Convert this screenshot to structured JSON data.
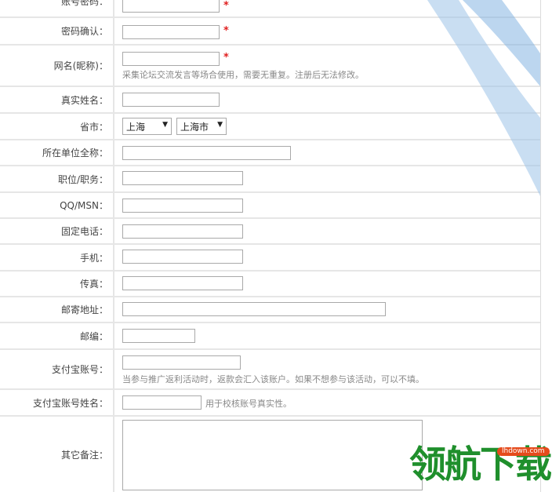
{
  "form": {
    "account_password": {
      "label": "账号密码：",
      "value": ""
    },
    "confirm_password": {
      "label": "密码确认：",
      "value": ""
    },
    "nickname": {
      "label": "网名(昵称)：",
      "value": "",
      "hint": "采集论坛交流发言等场合使用，需要无重复。注册后无法修改。"
    },
    "real_name": {
      "label": "真实姓名：",
      "value": ""
    },
    "province_city": {
      "label": "省市：",
      "province": "上海",
      "city": "上海市"
    },
    "organization": {
      "label": "所在单位全称：",
      "value": ""
    },
    "position": {
      "label": "职位/职务：",
      "value": ""
    },
    "qq_msn": {
      "label": "QQ/MSN：",
      "value": ""
    },
    "landline": {
      "label": "固定电话：",
      "value": ""
    },
    "mobile": {
      "label": "手机：",
      "value": ""
    },
    "fax": {
      "label": "传真：",
      "value": ""
    },
    "address": {
      "label": "邮寄地址：",
      "value": ""
    },
    "postcode": {
      "label": "邮编：",
      "value": ""
    },
    "alipay_account": {
      "label": "支付宝账号：",
      "value": "",
      "hint": "当参与推广返利活动时，返款会汇入该账户。如果不想参与该活动，可以不填。"
    },
    "alipay_name": {
      "label": "支付宝账号姓名：",
      "value": "",
      "hint": "用于校核账号真实性。"
    },
    "remarks": {
      "label": "其它备注：",
      "value": ""
    },
    "required_mark": "*"
  },
  "watermark": {
    "text": "领航下载",
    "badge": "lhdown.com",
    "color": "#1f8f2c",
    "badge_color": "#e54b1c"
  },
  "colors": {
    "border": "#e6e6e6",
    "required": "#e02020",
    "swoosh": "#7fb2e0"
  },
  "icons": {
    "select_arrow": "triangle-down-icon"
  }
}
